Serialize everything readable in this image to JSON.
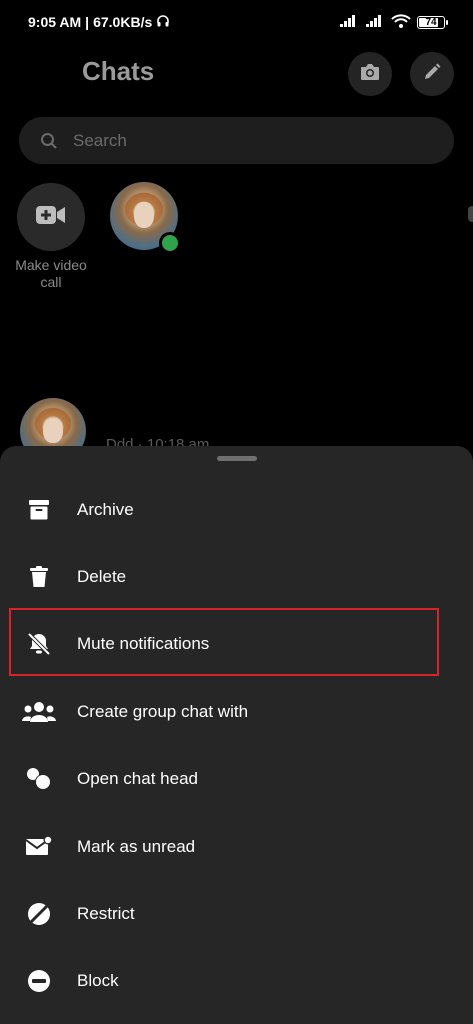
{
  "status_bar": {
    "time": "9:05 AM",
    "network_speed": "67.0KB/s",
    "battery": "74"
  },
  "header": {
    "title": "Chats"
  },
  "search": {
    "placeholder": "Search"
  },
  "stories": {
    "video_call_label": "Make video call"
  },
  "chat_list": {
    "preview": "Ddd · 10:18 am"
  },
  "menu": {
    "items": [
      {
        "label": "Archive",
        "icon": "archive-icon"
      },
      {
        "label": "Delete",
        "icon": "trash-icon"
      },
      {
        "label": "Mute notifications",
        "icon": "bell-off-icon"
      },
      {
        "label": "Create group chat with",
        "icon": "group-icon"
      },
      {
        "label": "Open chat head",
        "icon": "chat-head-icon"
      },
      {
        "label": "Mark as unread",
        "icon": "mail-icon"
      },
      {
        "label": "Restrict",
        "icon": "restrict-icon"
      },
      {
        "label": "Block",
        "icon": "block-icon"
      }
    ],
    "highlighted_item": "Mute notifications",
    "highlight_color": "#d9232c"
  },
  "colors": {
    "background": "#000000",
    "sheet": "#262626",
    "online": "#31a24c"
  }
}
